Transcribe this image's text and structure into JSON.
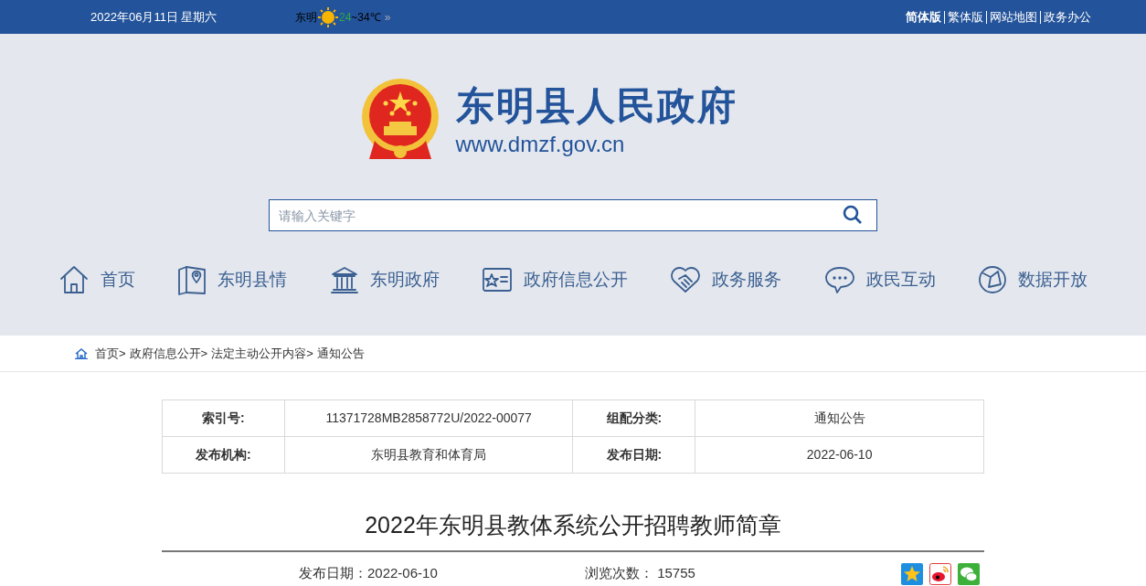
{
  "top_bar": {
    "date": "2022年06月11日 星期六",
    "weather": {
      "city": "东明",
      "low": "24",
      "high": "~34℃",
      "more": "»"
    },
    "links": [
      {
        "label": "简体版",
        "selected": true
      },
      {
        "label": "繁体版",
        "selected": false
      },
      {
        "label": "网站地图",
        "selected": false
      },
      {
        "label": "政务办公",
        "selected": false
      }
    ]
  },
  "header": {
    "site_name": "东明县人民政府",
    "url": "www.dmzf.gov.cn"
  },
  "search": {
    "placeholder": "请输入关键字"
  },
  "nav": [
    {
      "label": "首页",
      "kind": "home"
    },
    {
      "label": "东明县情",
      "kind": "map"
    },
    {
      "label": "东明政府",
      "kind": "building"
    },
    {
      "label": "政府信息公开",
      "kind": "card"
    },
    {
      "label": "政务服务",
      "kind": "handshake"
    },
    {
      "label": "政民互动",
      "kind": "chat"
    },
    {
      "label": "数据开放",
      "kind": "globe"
    }
  ],
  "breadcrumb": [
    "首页>",
    "政府信息公开>",
    "法定主动公开内容>",
    "通知公告"
  ],
  "info_table": [
    [
      {
        "label": "索引号:",
        "value": "11371728MB2858772U/2022-00077"
      },
      {
        "label": "组配分类:",
        "value": "通知公告"
      }
    ],
    [
      {
        "label": "发布机构:",
        "value": "东明县教育和体育局"
      },
      {
        "label": "发布日期:",
        "value": "2022-06-10"
      }
    ]
  ],
  "article": {
    "title": "2022年东明县教体系统公开招聘教师简章",
    "publish_date": "发布日期：2022-06-10",
    "views": "浏览次数： 15755"
  }
}
